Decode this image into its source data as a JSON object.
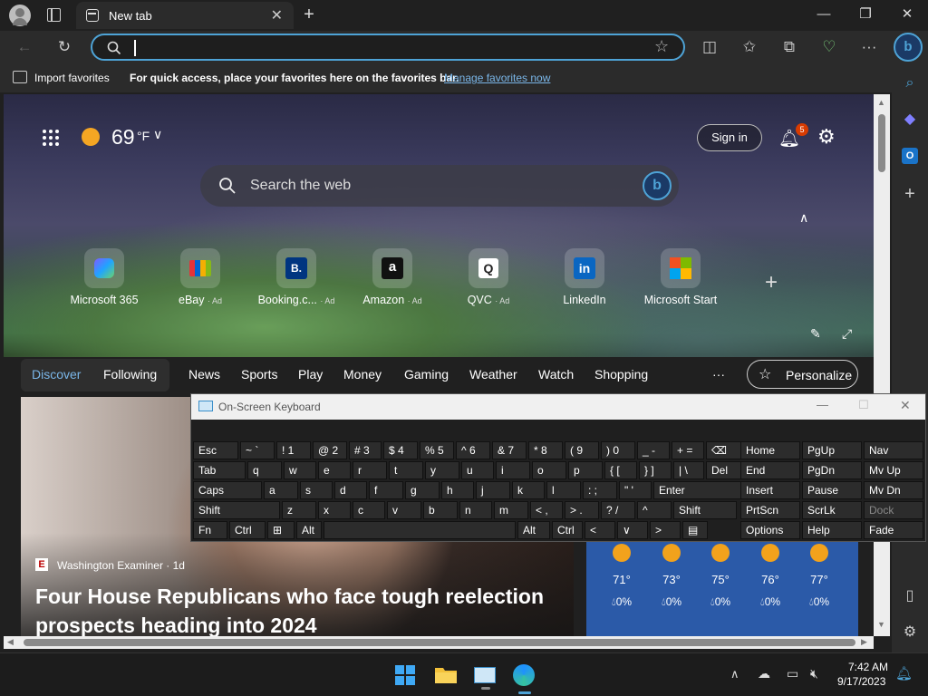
{
  "browser": {
    "tab": {
      "title": "New tab"
    },
    "address": {
      "value": "",
      "placeholder": ""
    },
    "favorites_bar": {
      "import_label": "Import favorites",
      "hint": "For quick access, place your favorites here on the favorites bar.",
      "manage_link": "Manage favorites now"
    }
  },
  "ntp": {
    "weather": {
      "temp": "69",
      "unit": "°F"
    },
    "sign_in": "Sign in",
    "notif_count": "5",
    "search_placeholder": "Search the web",
    "quick_links": [
      {
        "label": "Microsoft 365",
        "ad": "",
        "icon": "microsoft-365-icon"
      },
      {
        "label": "eBay",
        "ad": "· Ad",
        "icon": "ebay-icon"
      },
      {
        "label": "Booking.c...",
        "ad": "· Ad",
        "icon": "booking-icon",
        "glyph": "B."
      },
      {
        "label": "Amazon",
        "ad": "· Ad",
        "icon": "amazon-icon",
        "glyph": "a"
      },
      {
        "label": "QVC",
        "ad": "· Ad",
        "icon": "qvc-icon",
        "glyph": "Q"
      },
      {
        "label": "LinkedIn",
        "ad": "",
        "icon": "linkedin-icon",
        "glyph": "in"
      },
      {
        "label": "Microsoft Start",
        "ad": "",
        "icon": "microsoft-start-icon"
      }
    ],
    "nav": {
      "discover": "Discover",
      "following": "Following",
      "items": [
        "News",
        "Sports",
        "Play",
        "Money",
        "Gaming",
        "Weather",
        "Watch",
        "Shopping"
      ],
      "more": "···",
      "personalize": "Personalize"
    },
    "news": {
      "source": "Washington Examiner · 1d",
      "headline": "Four House Republicans who face tough reelection prospects heading into 2024"
    },
    "forecast": [
      {
        "temp": "71°",
        "precip": "0%"
      },
      {
        "temp": "73°",
        "precip": "0%"
      },
      {
        "temp": "75°",
        "precip": "0%"
      },
      {
        "temp": "76°",
        "precip": "0%"
      },
      {
        "temp": "77°",
        "precip": "0%"
      }
    ]
  },
  "osk": {
    "title": "On-Screen Keyboard",
    "rows": [
      [
        "Esc",
        "~ `",
        "! 1",
        "@ 2",
        "# 3",
        "$ 4",
        "% 5",
        "^ 6",
        "& 7",
        "* 8",
        "( 9",
        ") 0",
        "_ -",
        "+ =",
        "⌫"
      ],
      [
        "Tab",
        "q",
        "w",
        "e",
        "r",
        "t",
        "y",
        "u",
        "i",
        "o",
        "p",
        "{ [",
        "} ]",
        "| \\",
        "Del"
      ],
      [
        "Caps",
        "a",
        "s",
        "d",
        "f",
        "g",
        "h",
        "j",
        "k",
        "l",
        ": ;",
        "\" '",
        "Enter"
      ],
      [
        "Shift",
        "z",
        "x",
        "c",
        "v",
        "b",
        "n",
        "m",
        "< ,",
        "> .",
        "? /",
        "^",
        "Shift"
      ],
      [
        "Fn",
        "Ctrl",
        "⊞",
        "Alt",
        "",
        "Alt",
        "Ctrl",
        "<",
        "∨",
        ">",
        "▤"
      ]
    ],
    "nav_keys": [
      [
        "Home",
        "PgUp",
        "Nav"
      ],
      [
        "End",
        "PgDn",
        "Mv Up"
      ],
      [
        "Insert",
        "Pause",
        "Mv Dn"
      ],
      [
        "PrtScn",
        "ScrLk",
        "Dock"
      ],
      [
        "Options",
        "Help",
        "Fade"
      ]
    ]
  },
  "taskbar": {
    "time": "7:42 AM",
    "date": "9/17/2023"
  }
}
